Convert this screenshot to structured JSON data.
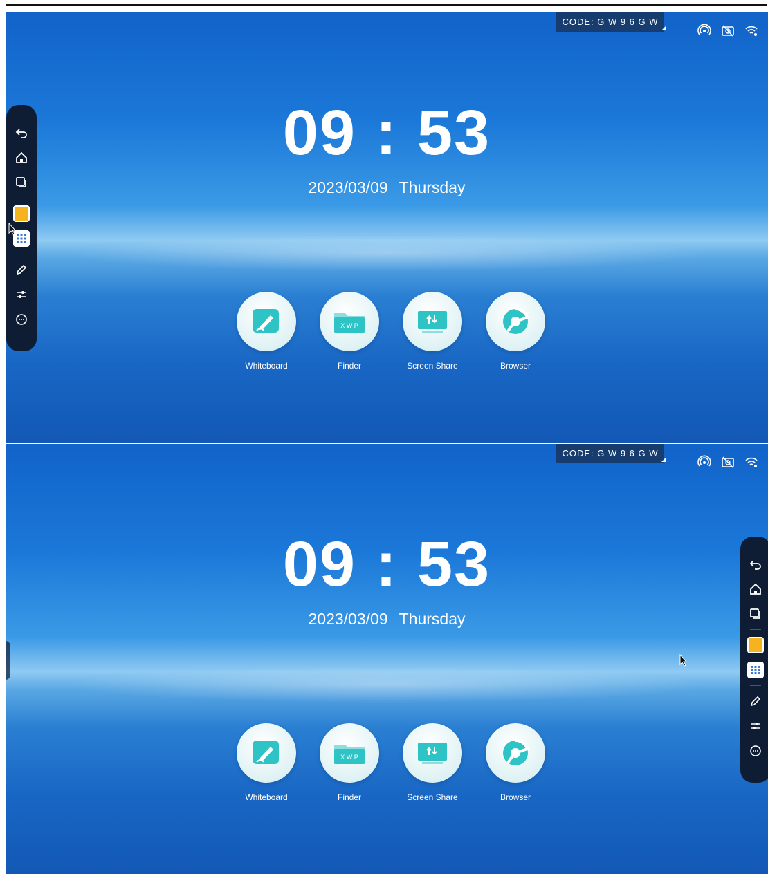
{
  "code_badge": "CODE: G W 9 6 G W",
  "clock": {
    "hour": "09",
    "sep": ":",
    "minute": "53"
  },
  "date": {
    "day": "2023/03/09",
    "weekday": "Thursday"
  },
  "apps": [
    {
      "label": "Whiteboard",
      "icon": "whiteboard-icon",
      "color": "#2ec4c6"
    },
    {
      "label": "Finder",
      "icon": "folder-icon",
      "badge": "X W P",
      "color": "#2ec4c6"
    },
    {
      "label": "Screen Share",
      "icon": "screen-share-icon",
      "color": "#2ec4c6"
    },
    {
      "label": "Browser",
      "icon": "browser-icon",
      "color": "#2ec4c6"
    }
  ],
  "toolbar_icons": [
    "back-icon",
    "home-icon",
    "multitask-icon",
    "note-app-icon",
    "apps-grid-icon",
    "pen-icon",
    "settings-sliders-icon",
    "more-icon"
  ],
  "status_icons": [
    "hotspot-icon",
    "no-camera-icon",
    "wifi-icon"
  ]
}
